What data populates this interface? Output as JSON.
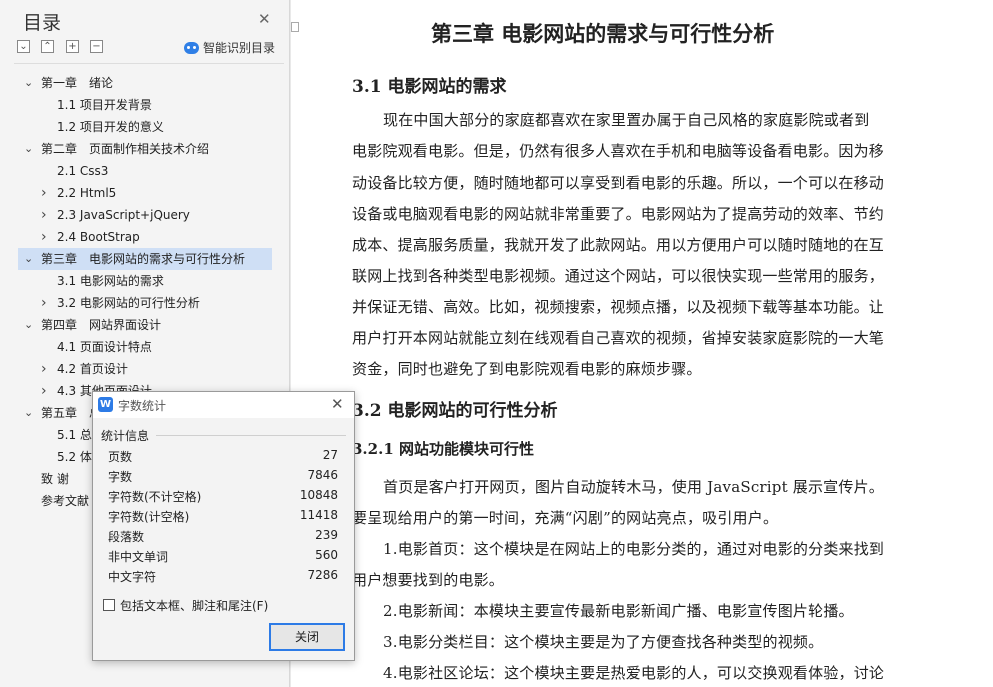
{
  "toc": {
    "title": "目录",
    "smart_label": "智能识别目录",
    "items": [
      {
        "label": "第一章　绪论",
        "arrow": "v",
        "selected": false
      },
      {
        "label": "1.1  项目开发背景",
        "arrow": "",
        "selected": false
      },
      {
        "label": "1.2  项目开发的意义",
        "arrow": "",
        "selected": false
      },
      {
        "label": "第二章　页面制作相关技术介绍",
        "arrow": "v",
        "selected": false
      },
      {
        "label": "2.1 Css3",
        "arrow": "",
        "selected": false
      },
      {
        "label": "2.2 Html5",
        "arrow": ">",
        "selected": false
      },
      {
        "label": "2.3 JavaScript+jQuery",
        "arrow": ">",
        "selected": false
      },
      {
        "label": "2.4 BootStrap",
        "arrow": ">",
        "selected": false
      },
      {
        "label": "第三章　电影网站的需求与可行性分析",
        "arrow": "v",
        "selected": true
      },
      {
        "label": "3.1 电影网站的需求",
        "arrow": "",
        "selected": false
      },
      {
        "label": "3.2 电影网站的可行性分析",
        "arrow": ">",
        "selected": false
      },
      {
        "label": "第四章　网站界面设计",
        "arrow": "v",
        "selected": false
      },
      {
        "label": "4.1  页面设计特点",
        "arrow": "",
        "selected": false
      },
      {
        "label": "4.2  首页设计",
        "arrow": ">",
        "selected": false
      },
      {
        "label": "4.3  其他页面设计",
        "arrow": ">",
        "selected": false
      },
      {
        "label": "第五章　总",
        "arrow": "v",
        "selected": false
      },
      {
        "label": "5.1  总",
        "arrow": "",
        "selected": false
      },
      {
        "label": "5.2 体",
        "arrow": "",
        "selected": false
      },
      {
        "label": "致  谢",
        "arrow": "",
        "selected": false
      },
      {
        "label": "参考文献",
        "arrow": "",
        "selected": false
      }
    ]
  },
  "document": {
    "lines": [
      {
        "text": "第三章  电影网站的需求与可行性分析",
        "style": "chap"
      },
      {
        "text": "3.1 电影网站的需求",
        "style": "sec"
      },
      {
        "text": "现在中国大部分的家庭都喜欢在家里置办属于自己风格的家庭影院或者到",
        "style": "para"
      },
      {
        "text": "电影院观看电影。但是，仍然有很多人喜欢在手机和电脑等设备看电影。因为移",
        "style": "para"
      },
      {
        "text": "动设备比较方便，随时随地都可以享受到看电影的乐趣。所以，一个可以在移动",
        "style": "para"
      },
      {
        "text": "设备或电脑观看电影的网站就非常重要了。电影网站为了提高劳动的效率、节约",
        "style": "para"
      },
      {
        "text": "成本、提高服务质量，我就开发了此款网站。用以方便用户可以随时随地的在互",
        "style": "para"
      },
      {
        "text": "联网上找到各种类型电影视频。通过这个网站，可以很快实现一些常用的服务，",
        "style": "para"
      },
      {
        "text": "并保证无错、高效。比如，视频搜索，视频点播，以及视频下载等基本功能。让",
        "style": "para"
      },
      {
        "text": "用户打开本网站就能立刻在线观看自己喜欢的视频，省掉安装家庭影院的一大笔",
        "style": "para"
      },
      {
        "text": "资金，同时也避免了到电影院观看电影的麻烦步骤。",
        "style": "para"
      },
      {
        "text": "3.2 电影网站的可行性分析",
        "style": "sec"
      },
      {
        "text": "3.2.1 网站功能模块可行性",
        "style": "sub"
      },
      {
        "text": "首页是客户打开网页，图片自动旋转木马，使用 JavaScript 展示宣传片。",
        "style": "para"
      },
      {
        "text": "要呈现给用户的第一时间，充满“闪剧”的网站亮点，吸引用户。",
        "style": "para"
      },
      {
        "text": "1.电影首页：这个模块是在网站上的电影分类的，通过对电影的分类来找到",
        "style": "para"
      },
      {
        "text": "用户想要找到的电影。",
        "style": "para"
      },
      {
        "text": "2.电影新闻：本模块主要宣传最新电影新闻广播、电影宣传图片轮播。",
        "style": "para"
      },
      {
        "text": "3.电影分类栏目：这个模块主要是为了方便查找各种类型的视频。",
        "style": "para"
      },
      {
        "text": "4.电影社区论坛：这个模块主要是热爱电影的人，可以交换观看体验，讨论",
        "style": "para"
      }
    ]
  },
  "word_count_dialog": {
    "title": "字数统计",
    "logo": "W",
    "group_label": "统计信息",
    "rows": [
      {
        "label": "页数",
        "value": "27"
      },
      {
        "label": "字数",
        "value": "7846"
      },
      {
        "label": "字符数(不计空格)",
        "value": "10848"
      },
      {
        "label": "字符数(计空格)",
        "value": "11418"
      },
      {
        "label": "段落数",
        "value": "239"
      },
      {
        "label": "非中文单词",
        "value": "560"
      },
      {
        "label": "中文字符",
        "value": "7286"
      }
    ],
    "checkbox_label": "包括文本框、脚注和尾注(F)",
    "checkbox_checked": false,
    "close_button": "关闭"
  }
}
